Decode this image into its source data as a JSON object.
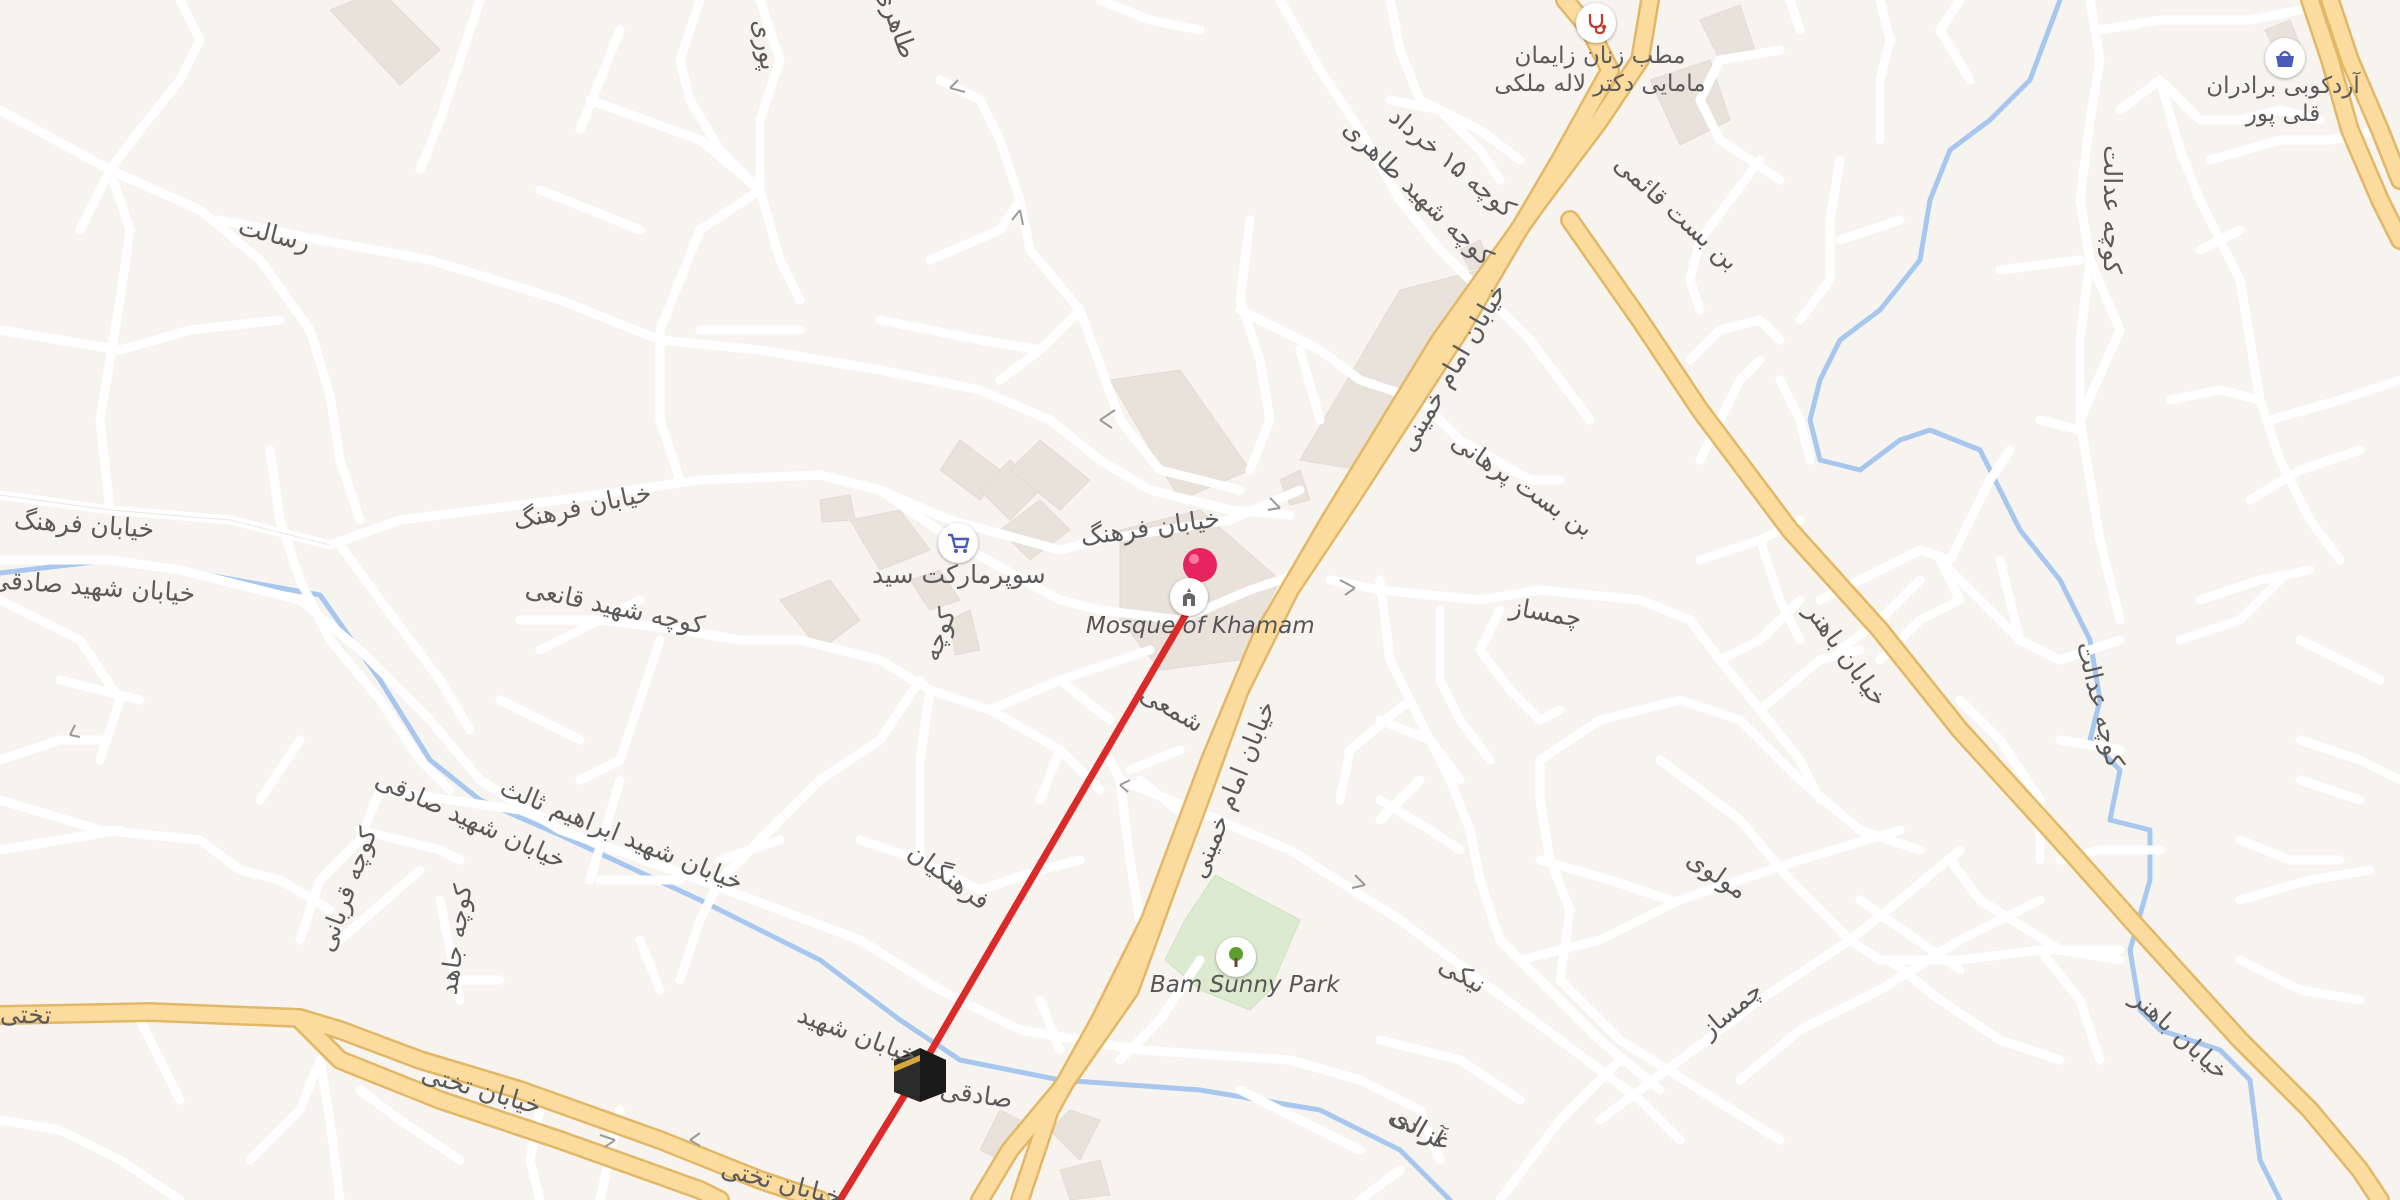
{
  "map": {
    "colors": {
      "background": "#f7f4f0",
      "minor_road": "#e0dcd6",
      "major_road_fill": "#fbdc9e",
      "major_road_casing": "#e2b766",
      "river": "#a7c7ef",
      "building": "#e9e2da",
      "park": "#dcebd0",
      "route": "#dc2a2a",
      "pin": "#e8245e"
    },
    "labels": {
      "khiaban_farhang_west": "خیابان فرهنگ",
      "shahid_sadeghi_west": "خیابان شهید صادقی",
      "resalat": "رسالت",
      "khiaban_farhang_mid": "خیابان فرهنگ",
      "khiaban_farhang_east": "خیابان فرهنگ",
      "koocheh_shahid_ghanei": "کوچه شهید قانعی",
      "supermarket": "سوپرمارکت سید",
      "koocheh_small": "کوچه",
      "mosque": "Mosque of Khamam",
      "shahid_sadeghi_diag": "خیابان شهید صادقی",
      "shahid_ebrahim": "خیابان شهید ابراهیم ثالث",
      "koocheh_ghorbani": "کوچه قربانی",
      "koocheh_jahed": "کوچه جاهد",
      "takhti_west": "تختی",
      "takhti_main": "خیابان تختی",
      "takhti_lower": "خیابان تختی",
      "shahid_sadeghi_low": "خیابان شهید",
      "sadeghi_short": "صادقی",
      "farhangian": "فرهنگیان",
      "shomai": "شمعی",
      "azadi": "آزادی",
      "imam_khomeini_upper": "خیابان امام خمینی",
      "imam_khomeini_lower": "خیابان امام خمینی",
      "park": "Bam Sunny Park",
      "clinic": "مطب زنان زایمان مامایی دکتر لاله ملکی",
      "koocheh_15_khordad": "کوچه ۱۵ خرداد",
      "koocheh_shahid_tahari": "کوچه شهید طاهری",
      "bonbast_ghaei": "بن بست قائمی",
      "bonbast_parhani": "بن بست پرهانی",
      "chamsaz": "چمساز",
      "bahonar": "خیابان باهنر",
      "bahonar_lower": "خیابان باهنر",
      "mowlavi": "مولوی",
      "neyki": "نیکی",
      "chamsaz_low": "چمساز",
      "ghazali": "غزالی",
      "bakery": "آردکوبی برادران قلی پور",
      "koocheh_edalat_top": "کوچه عدالت",
      "koocheh_edalat_mid": "کوچه عدالت",
      "taher": "طاهری",
      "partial_top": "پوری"
    },
    "icons": {
      "pin": "map-pin-icon",
      "mosque": "mosque-icon",
      "kaaba": "kaaba-icon",
      "cart": "shopping-cart-icon",
      "tree": "park-tree-icon",
      "stethoscope": "stethoscope-icon",
      "basket": "shopping-basket-icon"
    }
  }
}
